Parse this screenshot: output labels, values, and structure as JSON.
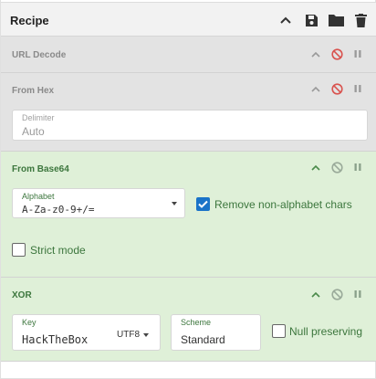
{
  "recipe": {
    "title": "Recipe"
  },
  "operations": {
    "url_decode": {
      "name": "URL Decode",
      "disabled": true
    },
    "from_hex": {
      "name": "From Hex",
      "disabled": true,
      "delimiter_label": "Delimiter",
      "delimiter_value": "Auto"
    },
    "from_base64": {
      "name": "From Base64",
      "disabled": false,
      "alphabet_label": "Alphabet",
      "alphabet_value": "A-Za-z0-9+/=",
      "remove_non_alphabet_label": "Remove non-alphabet chars",
      "remove_non_alphabet_checked": true,
      "strict_mode_label": "Strict mode",
      "strict_mode_checked": false
    },
    "xor": {
      "name": "XOR",
      "disabled": false,
      "key_label": "Key",
      "key_value": "HackTheBox",
      "key_encoding": "UTF8",
      "scheme_label": "Scheme",
      "scheme_value": "Standard",
      "null_preserving_label": "Null preserving",
      "null_preserving_checked": false
    }
  },
  "colors": {
    "enabled_bg": "#dff0d8",
    "enabled_text": "#3c763d",
    "disabled_bg": "#e3e3e3",
    "disable_icon_red": "#d9534f",
    "checkbox_blue": "#1a73c8"
  },
  "icons": {
    "header": [
      "chevron-up-icon",
      "save-icon",
      "folder-icon",
      "trash-icon"
    ],
    "operation_controls": [
      "chevron-up-icon",
      "disable-icon",
      "breakpoint-icon"
    ]
  }
}
